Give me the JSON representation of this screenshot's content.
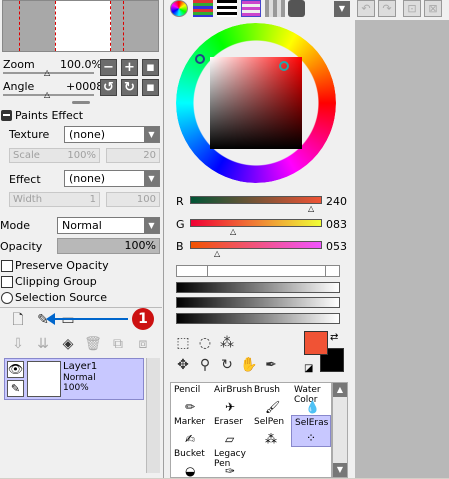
{
  "navigator": {
    "zoom_label": "Zoom",
    "zoom_value": "100.0%",
    "angle_label": "Angle",
    "angle_value": "+0008"
  },
  "paints_effect": {
    "title": "Paints Effect",
    "texture_label": "Texture",
    "texture_value": "(none)",
    "scale_label": "Scale",
    "scale_value": "100%",
    "scale_num": "20",
    "effect_label": "Effect",
    "effect_value": "(none)",
    "width_label": "Width",
    "width_value": "1",
    "width_num": "100"
  },
  "layer_props": {
    "mode_label": "Mode",
    "mode_value": "Normal",
    "opacity_label": "Opacity",
    "opacity_value": "100%",
    "preserve_opacity": "Preserve Opacity",
    "clipping_group": "Clipping Group",
    "selection_source": "Selection Source"
  },
  "annotation": {
    "badge": "1",
    "arrow_color": "#0066cc",
    "badge_color": "#cc1111"
  },
  "layer": {
    "name": "Layer1",
    "mode": "Normal",
    "opacity": "100%"
  },
  "color": {
    "r_label": "R",
    "r_value": "240",
    "g_label": "G",
    "g_value": "083",
    "b_label": "B",
    "b_value": "053",
    "primary": "#f05335",
    "secondary": "#000000"
  },
  "tools": [
    {
      "name": "Pencil",
      "icon": "pencil-icon"
    },
    {
      "name": "AirBrush",
      "icon": "airbrush-icon"
    },
    {
      "name": "Brush",
      "icon": "brush-icon"
    },
    {
      "name": "Water Color",
      "icon": "watercolor-icon"
    },
    {
      "name": "Marker",
      "icon": "marker-icon"
    },
    {
      "name": "Eraser",
      "icon": "eraser-icon"
    },
    {
      "name": "SelPen",
      "icon": "selpen-icon"
    },
    {
      "name": "SelEras",
      "icon": "seleras-icon"
    },
    {
      "name": "Bucket",
      "icon": "bucket-icon"
    },
    {
      "name": "Legacy Pen",
      "icon": "legacypen-icon"
    }
  ]
}
